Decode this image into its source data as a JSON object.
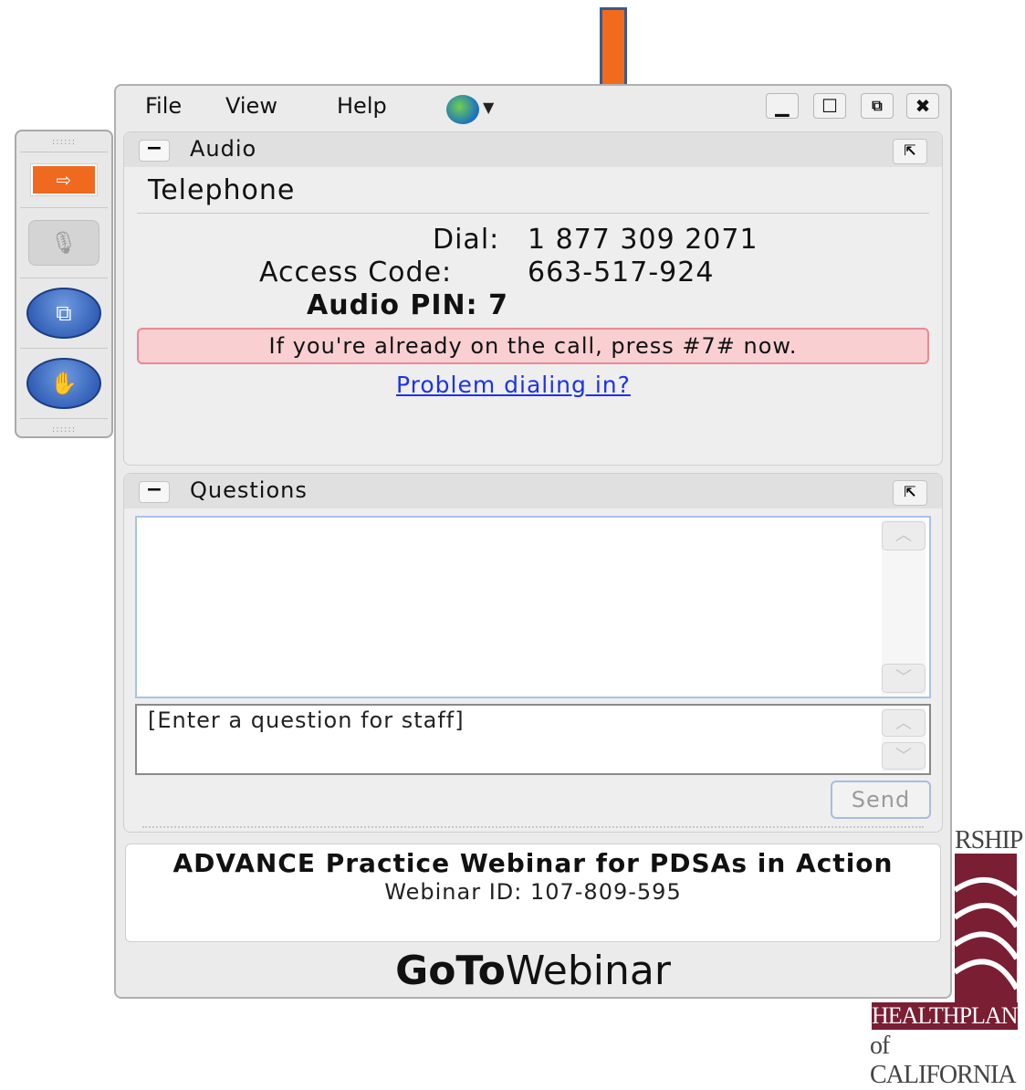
{
  "menu": {
    "file": "File",
    "view": "View",
    "help": "Help"
  },
  "window_controls": {
    "minimize": "▁",
    "maximize": "☐",
    "restore": "⧉",
    "close": "✖"
  },
  "audio": {
    "title": "Audio",
    "collapse": "−",
    "popout": "⇱",
    "telephone": "Telephone",
    "dial_label": "Dial:",
    "dial_value": "1 877 309 2071",
    "access_label": "Access Code:",
    "access_value": "663-517-924",
    "pin": "Audio PIN: 7",
    "alert": "If you're already on the call, press #7# now.",
    "problem_link": "Problem dialing in?"
  },
  "questions": {
    "title": "Questions",
    "collapse": "−",
    "popout": "⇱",
    "input_text": "[Enter a question for staff]",
    "send": "Send"
  },
  "webinar": {
    "title": "ADVANCE Practice Webinar for PDSAs in Action",
    "id": "Webinar ID: 107-809-595"
  },
  "brand": {
    "bold": "GoTo",
    "light": "Webinar"
  },
  "logo": {
    "top": "RSHIP",
    "middle": "HEALTHPLAN",
    "bottom": "of CALIFORNIA"
  },
  "icons": {
    "toolbar_arrow": "arrow-right-icon",
    "mic": "microphone-icon",
    "screen": "screen-share-icon",
    "hand": "raise-hand-icon",
    "globe": "globe-icon"
  },
  "colors": {
    "accent_orange": "#f26a1c",
    "link_blue": "#1d33e6",
    "logo_maroon": "#7a1e33",
    "alert_pink": "#f9cfd2"
  }
}
